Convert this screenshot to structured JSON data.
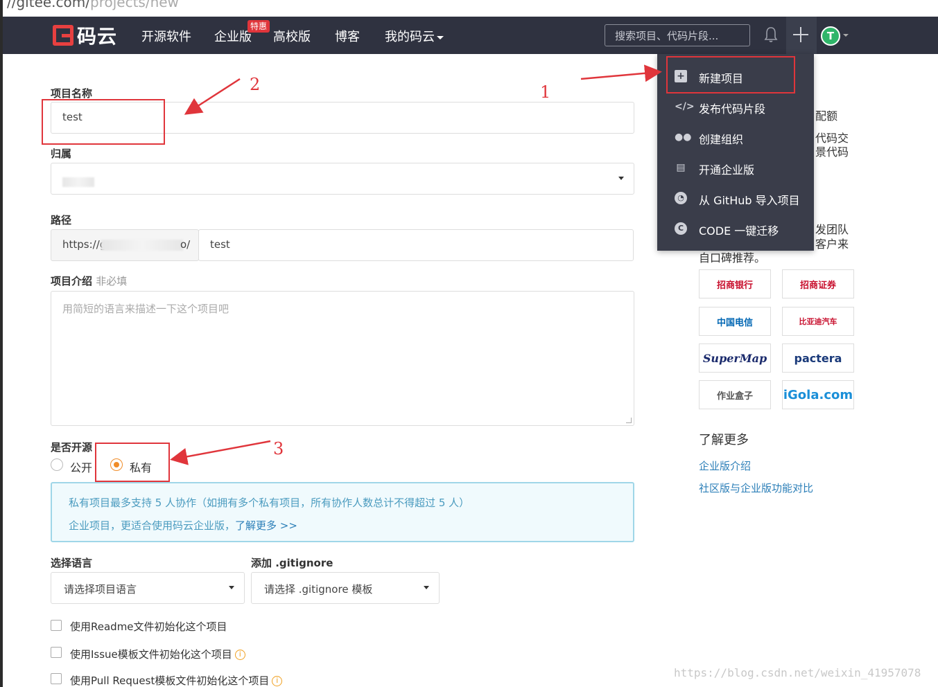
{
  "browser": {
    "url_visible": "//gitee.com/",
    "url_dim": "projects/new"
  },
  "navbar": {
    "logo_text": "码云",
    "items": [
      "开源软件",
      "企业版",
      "高校版",
      "博客",
      "我的码云"
    ],
    "hot_badge": "特惠",
    "search_placeholder": "搜索项目、代码片段...",
    "avatar_letter": "T"
  },
  "form": {
    "name_label": "项目名称",
    "name_value": "test",
    "owner_label": "归属",
    "path_label": "路径",
    "path_prefix_start": "https://g",
    "path_prefix_end": "o/",
    "path_value": "test",
    "desc_label": "项目介绍",
    "desc_optional": "非必填",
    "desc_placeholder": "用简短的语言来描述一下这个项目吧",
    "open_label": "是否开源",
    "radio_public": "公开",
    "radio_private": "私有",
    "info_line1": "私有项目最多支持 5 人协作（如拥有多个私有项目，所有协作人数总计不得超过 5 人）",
    "info_line2": "企业项目，更适合使用码云企业版，",
    "info_link": "了解更多 >>",
    "lang_label": "选择语言",
    "lang_placeholder": "请选择项目语言",
    "gitignore_label": "添加 .gitignore",
    "gitignore_placeholder": "请选择 .gitignore 模板",
    "check_readme": "使用Readme文件初始化这个项目",
    "check_issue": "使用Issue模板文件初始化这个项目",
    "check_pr": "使用Pull Request模板文件初始化这个项目"
  },
  "dropdown": {
    "items": [
      {
        "label": "新建项目",
        "icon": "plus-square-icon"
      },
      {
        "label": "发布代码片段",
        "icon": "code-icon"
      },
      {
        "label": "创建组织",
        "icon": "users-icon"
      },
      {
        "label": "开通企业版",
        "icon": "building-icon"
      },
      {
        "label": "从 GitHub 导入项目",
        "icon": "github-icon"
      },
      {
        "label": "CODE 一键迁移",
        "icon": "code-migrate-icon"
      }
    ]
  },
  "sidebar": {
    "partial_1": "配额",
    "partial_2": "代码交",
    "partial_3": "景代码",
    "partial_4": "发团队",
    "partial_5": "客户来",
    "partial_6": "自口碑推荐。",
    "logos": [
      "招商银行",
      "招商证券",
      "中国电信",
      "比亚迪汽车",
      "SuperMap",
      "pactera",
      "作业盒子",
      "iGola.com"
    ],
    "logo_subs": [
      "CHINA MERCHANTS BANK",
      "CHINA TELECOM",
      "文 思 海 辉"
    ],
    "learn_more": "了解更多",
    "link_1": "企业版介绍",
    "link_2": "社区版与企业版功能对比"
  },
  "annotations": {
    "n1": "1",
    "n2": "2",
    "n3": "3",
    "color": "#e0353b"
  },
  "watermark": "https://blog.csdn.net/weixin_41957078"
}
